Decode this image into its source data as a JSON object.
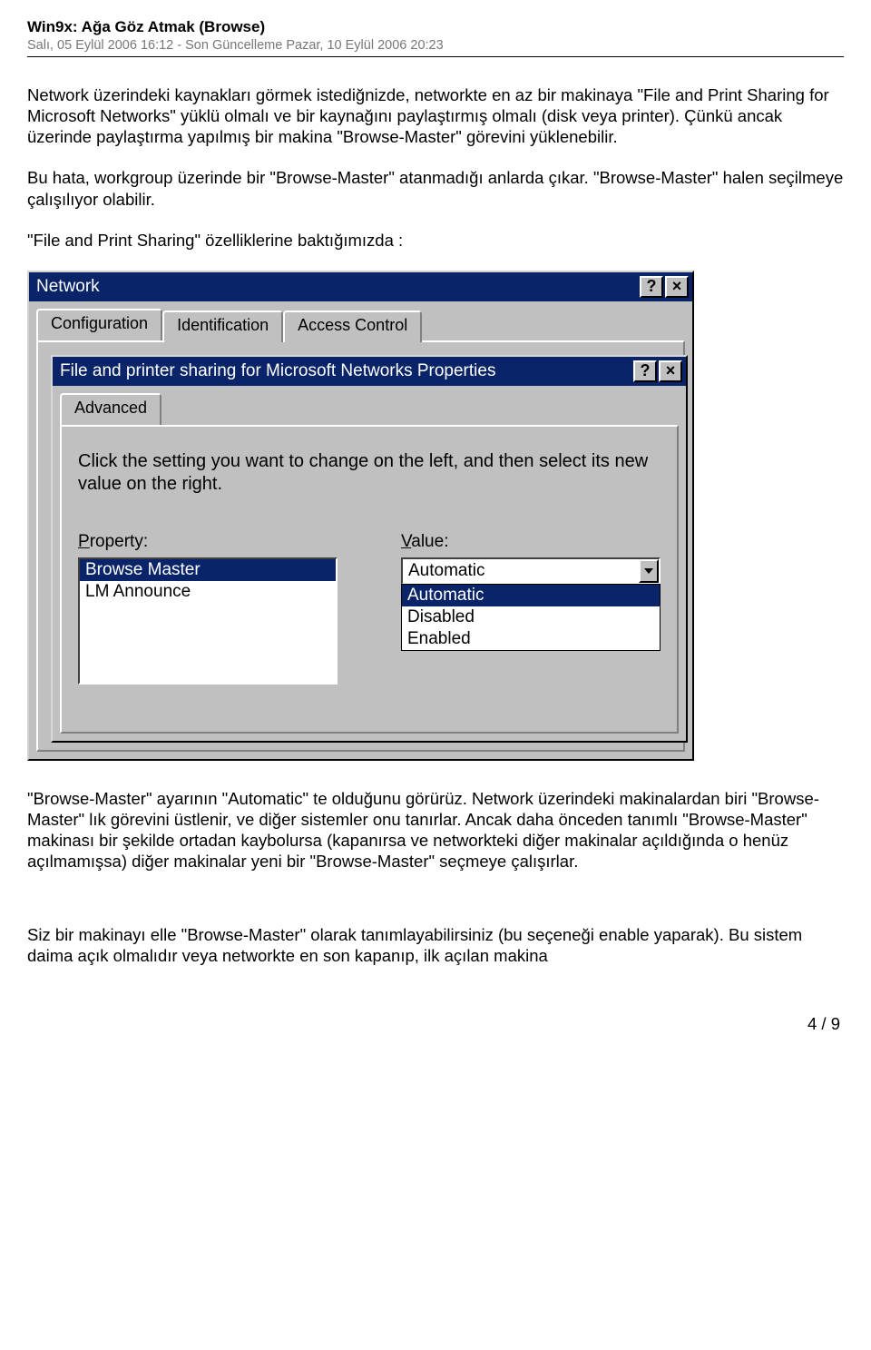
{
  "doc": {
    "title": "Win9x: Ağa Göz Atmak (Browse)",
    "subtitle": "Salı, 05 Eylül 2006 16:12 - Son Güncelleme Pazar, 10 Eylül 2006 20:23"
  },
  "paras": {
    "p1": "Network üzerindeki kaynakları görmek istediğnizde, networkte en az bir makinaya &quot;File and Print Sharing for Microsoft Networks&quot; yüklü olmalı ve bir kaynağını paylaştırmış olmalı (disk veya printer). Çünkü ancak üzerinde paylaştırma yapılmış bir makina &quot;Browse-Master&quot; görevini yüklenebilir.",
    "p2": "Bu hata, workgroup üzerinde bir &quot;Browse-Master&quot; atanmadığı anlarda çıkar. &quot;Browse-Master&quot; halen seçilmeye çalışılıyor olabilir.",
    "p3": "&quot;File and Print Sharing&quot; özelliklerine baktığımızda :",
    "p4": "&quot;Browse-Master&quot; ayarının &quot;Automatic&quot; te olduğunu görürüz. Network üzerindeki makinalardan biri &quot;Browse-Master&quot; lık görevini üstlenir, ve diğer sistemler onu tanırlar. Ancak daha önceden tanımlı &quot;Browse-Master&quot; makinası bir şekilde ortadan kaybolursa (kapanırsa ve networkteki diğer makinalar açıldığında o henüz açılmamışsa) diğer makinalar yeni bir &quot;Browse-Master&quot; seçmeye çalışırlar.",
    "p5": "Siz bir makinayı elle &quot;Browse-Master&quot; olarak tanımlayabilirsiniz (bu seçeneği enable yaparak). Bu sistem daima açık olmalıdır veya networkte en son kapanıp, ilk açılan makina"
  },
  "outer": {
    "title": "Network",
    "help": "?",
    "close": "×",
    "tabs": {
      "t1": "Configuration",
      "t2": "Identification",
      "t3": "Access Control"
    }
  },
  "inner": {
    "title": "File and printer sharing for Microsoft Networks Properties",
    "tab": "Advanced",
    "instr": "Click the setting you want to change on the left, and then select its new value on the right.",
    "propLabel": "Property:",
    "valueLabel": "Value:",
    "properties": {
      "p0": "Browse Master",
      "p1": "LM Announce"
    },
    "combo": "Automatic",
    "options": {
      "o0": "Automatic",
      "o1": "Disabled",
      "o2": "Enabled"
    }
  },
  "footer": "4 / 9"
}
